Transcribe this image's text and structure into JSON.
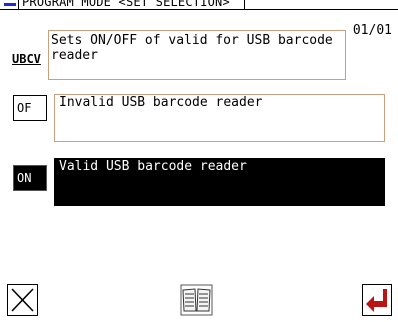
{
  "header": {
    "title": "PROGRAM MODE <SET SELECTION>",
    "page": "01/01"
  },
  "setting": {
    "code": "UBCV",
    "description": "Sets ON/OFF of valid for USB barcode\nreader"
  },
  "options": [
    {
      "button": "OF",
      "label": "Invalid USB barcode reader",
      "selected": false
    },
    {
      "button": "ON",
      "label": "Valid USB barcode reader",
      "selected": true
    }
  ],
  "icons": {
    "close": "close-icon",
    "manual": "book-icon",
    "enter": "enter-arrow-icon"
  },
  "colors": {
    "title_dash": "#1e2ad6",
    "enter_arrow": "#b81414",
    "selected_bg": "#000000",
    "box_border": "#c8a080"
  }
}
